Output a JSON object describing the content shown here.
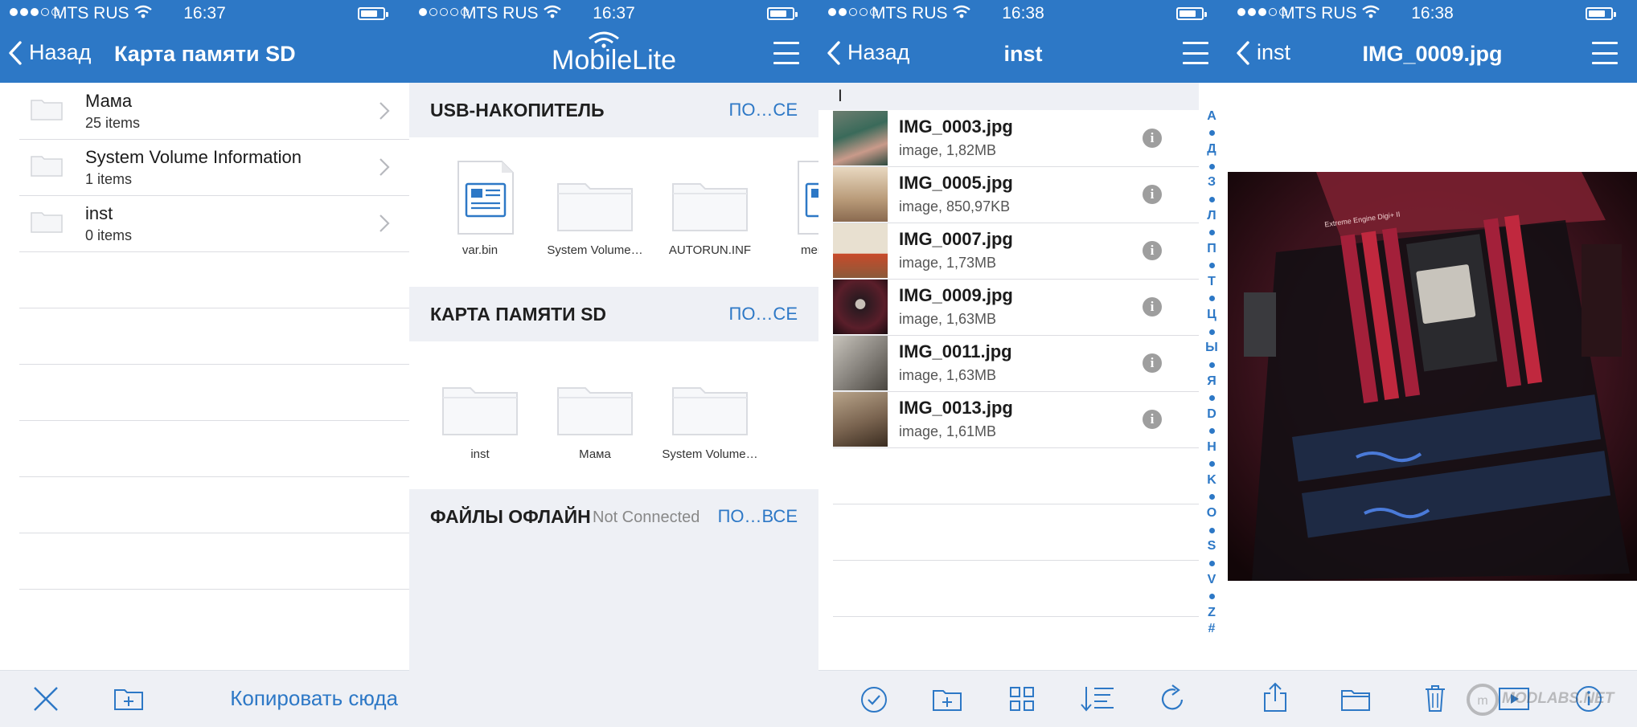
{
  "status": {
    "carrier": "MTS RUS",
    "times": [
      "16:37",
      "16:37",
      "16:38",
      "16:38"
    ]
  },
  "panel1": {
    "nav": {
      "back_label": "Назад",
      "title": "Карта памяти SD"
    },
    "rows": [
      {
        "name": "Мама",
        "sub": "25 items"
      },
      {
        "name": "System Volume Information",
        "sub": "1 items"
      },
      {
        "name": "inst",
        "sub": "0 items"
      }
    ],
    "toolbar": {
      "copy_label": "Копировать сюда"
    }
  },
  "panel2": {
    "nav": {
      "logo": "MobileLite"
    },
    "sections": [
      {
        "title": "USB-НАКОПИТЕЛЬ",
        "subtitle": "",
        "more": "ПО…СЕ",
        "items": [
          {
            "label": "var.bin",
            "icon": "document-icon"
          },
          {
            "label": "System Volume…",
            "icon": "folder-icon"
          },
          {
            "label": "AUTORUN.INF",
            "icon": "folder-icon"
          },
          {
            "label": "men",
            "icon": "document-icon"
          }
        ]
      },
      {
        "title": "КАРТА ПАМЯТИ SD",
        "subtitle": "",
        "more": "ПО…СЕ",
        "items": [
          {
            "label": "inst",
            "icon": "folder-icon"
          },
          {
            "label": "Мама",
            "icon": "folder-icon"
          },
          {
            "label": "System Volume…",
            "icon": "folder-icon"
          }
        ]
      },
      {
        "title": "ФАЙЛЫ ОФЛАЙН",
        "subtitle": "Not Connected",
        "more": "ПО…ВСЕ",
        "items": []
      }
    ]
  },
  "panel3": {
    "nav": {
      "back_label": "Назад",
      "title": "inst"
    },
    "section_letter": "I",
    "files": [
      {
        "name": "IMG_0003.jpg",
        "meta": "image, 1,82MB",
        "thumb_color": "#3a6a5a"
      },
      {
        "name": "IMG_0005.jpg",
        "meta": "image, 850,97KB",
        "thumb_color": "#b89a78"
      },
      {
        "name": "IMG_0007.jpg",
        "meta": "image, 1,73MB",
        "thumb_color": "#c87a4a"
      },
      {
        "name": "IMG_0009.jpg",
        "meta": "image, 1,63MB",
        "thumb_color": "#5a1e2a"
      },
      {
        "name": "IMG_0011.jpg",
        "meta": "image, 1,63MB",
        "thumb_color": "#8a8680"
      },
      {
        "name": "IMG_0013.jpg",
        "meta": "image, 1,61MB",
        "thumb_color": "#7a6450"
      }
    ],
    "index": [
      "А",
      "•",
      "Д",
      "•",
      "З",
      "•",
      "Л",
      "•",
      "П",
      "•",
      "Т",
      "•",
      "Ц",
      "•",
      "Ы",
      "•",
      "Я",
      "•",
      "D",
      "•",
      "H",
      "•",
      "K",
      "•",
      "O",
      "•",
      "S",
      "•",
      "V",
      "•",
      "Z",
      "#"
    ]
  },
  "panel4": {
    "nav": {
      "back_label": "inst",
      "title": "IMG_0009.jpg"
    },
    "photo_label": "Extreme Engine Digi+ II",
    "watermark": "MODLABS.NET"
  }
}
